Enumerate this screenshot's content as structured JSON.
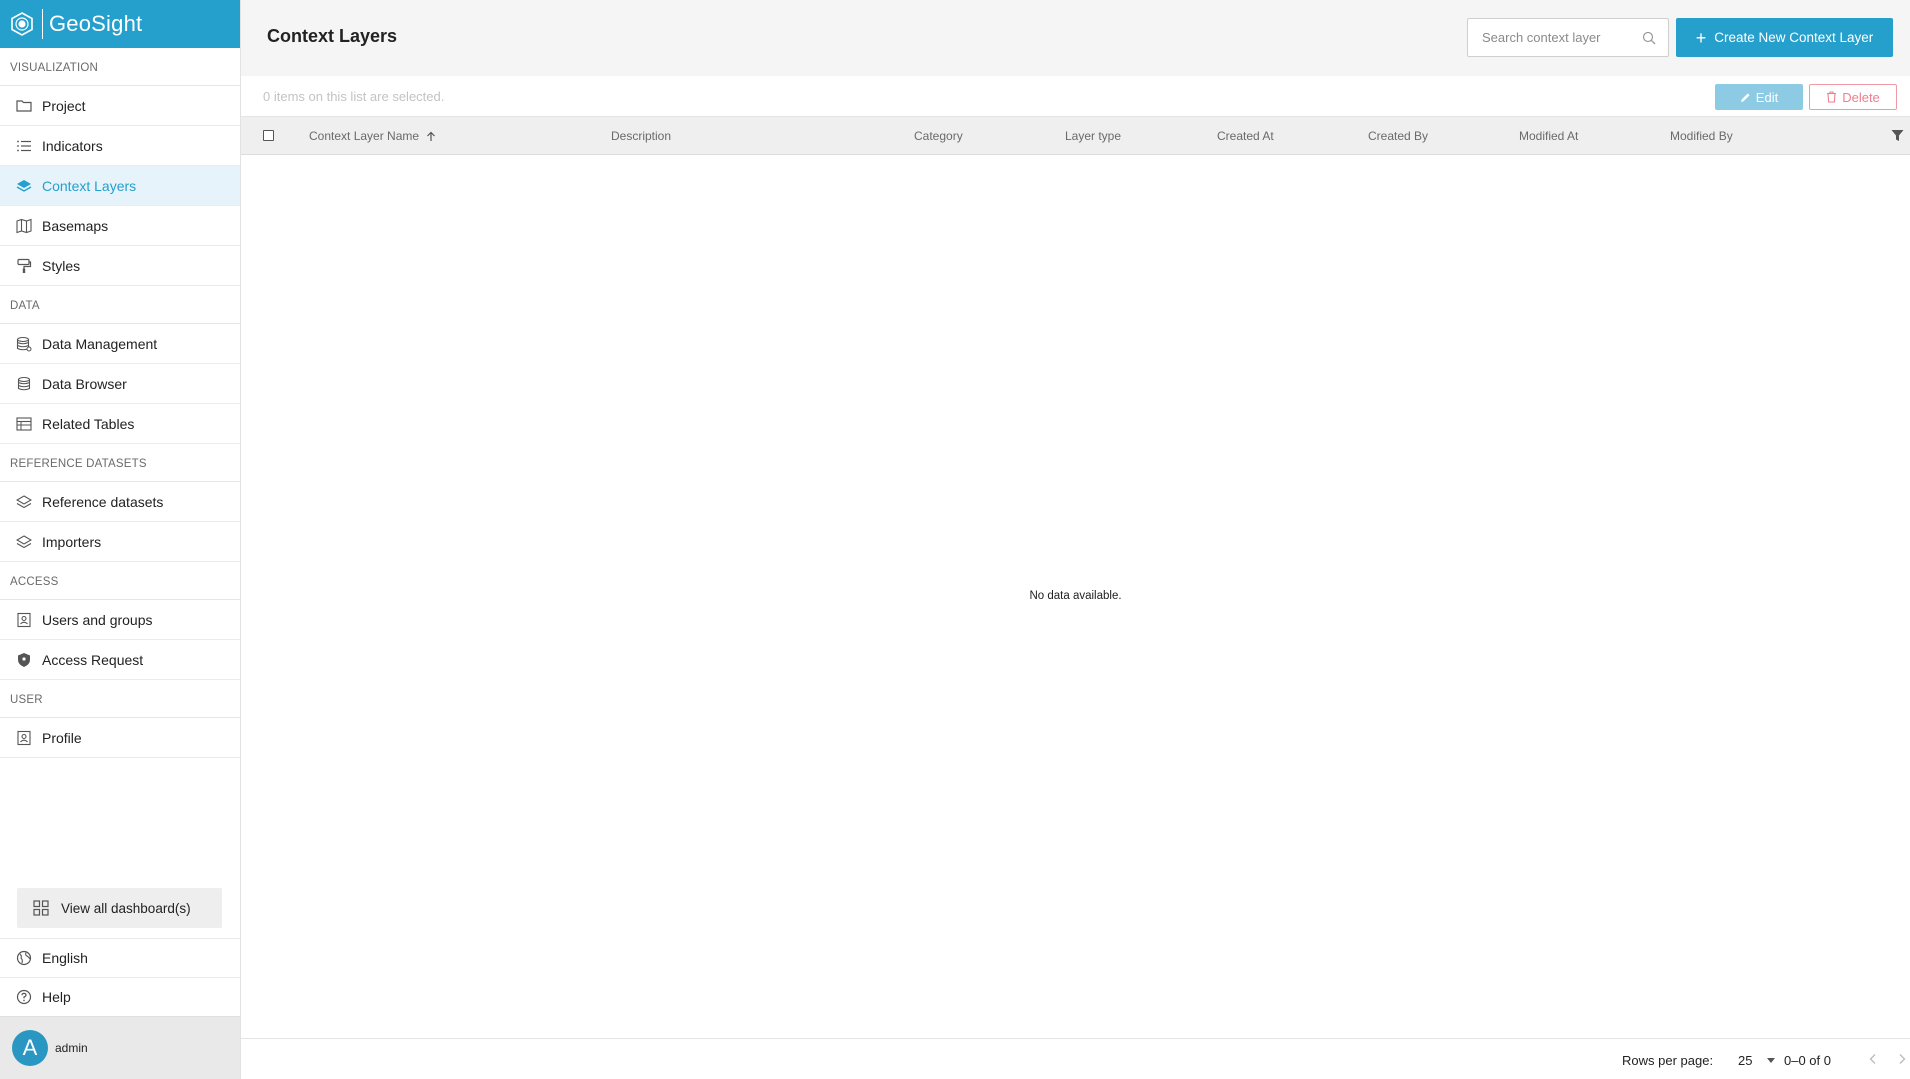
{
  "brand": {
    "name": "GeoSight"
  },
  "sidebar": {
    "sections": [
      {
        "label": "VISUALIZATION",
        "items": [
          {
            "label": "Project",
            "icon": "folder-icon"
          },
          {
            "label": "Indicators",
            "icon": "list-icon"
          },
          {
            "label": "Context Layers",
            "icon": "layers-icon",
            "active": true
          },
          {
            "label": "Basemaps",
            "icon": "map-icon"
          },
          {
            "label": "Styles",
            "icon": "paint-roller-icon"
          }
        ]
      },
      {
        "label": "DATA",
        "items": [
          {
            "label": "Data Management",
            "icon": "database-gear-icon"
          },
          {
            "label": "Data Browser",
            "icon": "database-icon"
          },
          {
            "label": "Related Tables",
            "icon": "table-icon"
          }
        ]
      },
      {
        "label": "REFERENCE DATASETS",
        "items": [
          {
            "label": "Reference datasets",
            "icon": "layers-outline-icon"
          },
          {
            "label": "Importers",
            "icon": "layers-outline-icon"
          }
        ]
      },
      {
        "label": "ACCESS",
        "items": [
          {
            "label": "Users and groups",
            "icon": "user-card-icon"
          },
          {
            "label": "Access Request",
            "icon": "shield-icon"
          }
        ]
      },
      {
        "label": "USER",
        "items": [
          {
            "label": "Profile",
            "icon": "user-card-icon"
          }
        ]
      }
    ],
    "view_all": "View all dashboard(s)",
    "language": "English",
    "help": "Help",
    "user": {
      "initial": "A",
      "name": "admin"
    }
  },
  "header": {
    "title": "Context Layers",
    "search_placeholder": "Search context layer",
    "create_button": "Create New Context Layer"
  },
  "selection": {
    "text": "0 items on this list are selected.",
    "edit_label": "Edit",
    "delete_label": "Delete"
  },
  "table": {
    "columns": [
      "Context Layer Name",
      "Description",
      "Category",
      "Layer type",
      "Created At",
      "Created By",
      "Modified At",
      "Modified By"
    ],
    "empty": "No data available."
  },
  "pagination": {
    "rows_label": "Rows per page:",
    "rows_value": "25",
    "range": "0–0 of 0"
  },
  "colors": {
    "accent": "#259fcc",
    "danger": "#ef7e8f",
    "active_bg": "#e6f3fa"
  }
}
